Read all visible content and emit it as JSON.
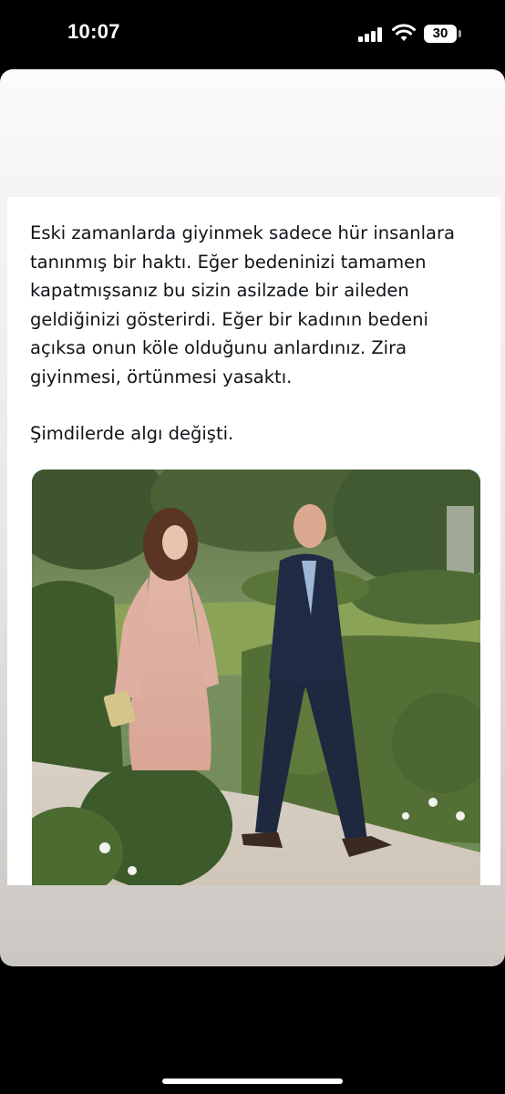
{
  "status_bar": {
    "time": "10:07",
    "battery_level": "30",
    "icons": [
      "signal-icon",
      "wifi-icon",
      "battery-icon"
    ]
  },
  "tweet": {
    "paragraphs": [
      "Eski zamanlarda giyinmek sadece hür insanlara tanınmış bir haktı. Eğer bedeninizi tamamen kapatmışsanız bu sizin asilzade bir aileden geldiğinizi gösterirdi. Eğer bir kadının bedeni açıksa onun köle olduğunu anlardınız. Zira giyinmesi, örtünmesi yasaktı.",
      "Şimdilerde algı değişti."
    ]
  },
  "colors": {
    "text": "#0f1419",
    "status_bar_bg": "#000000",
    "card_bg": "#ffffff"
  }
}
